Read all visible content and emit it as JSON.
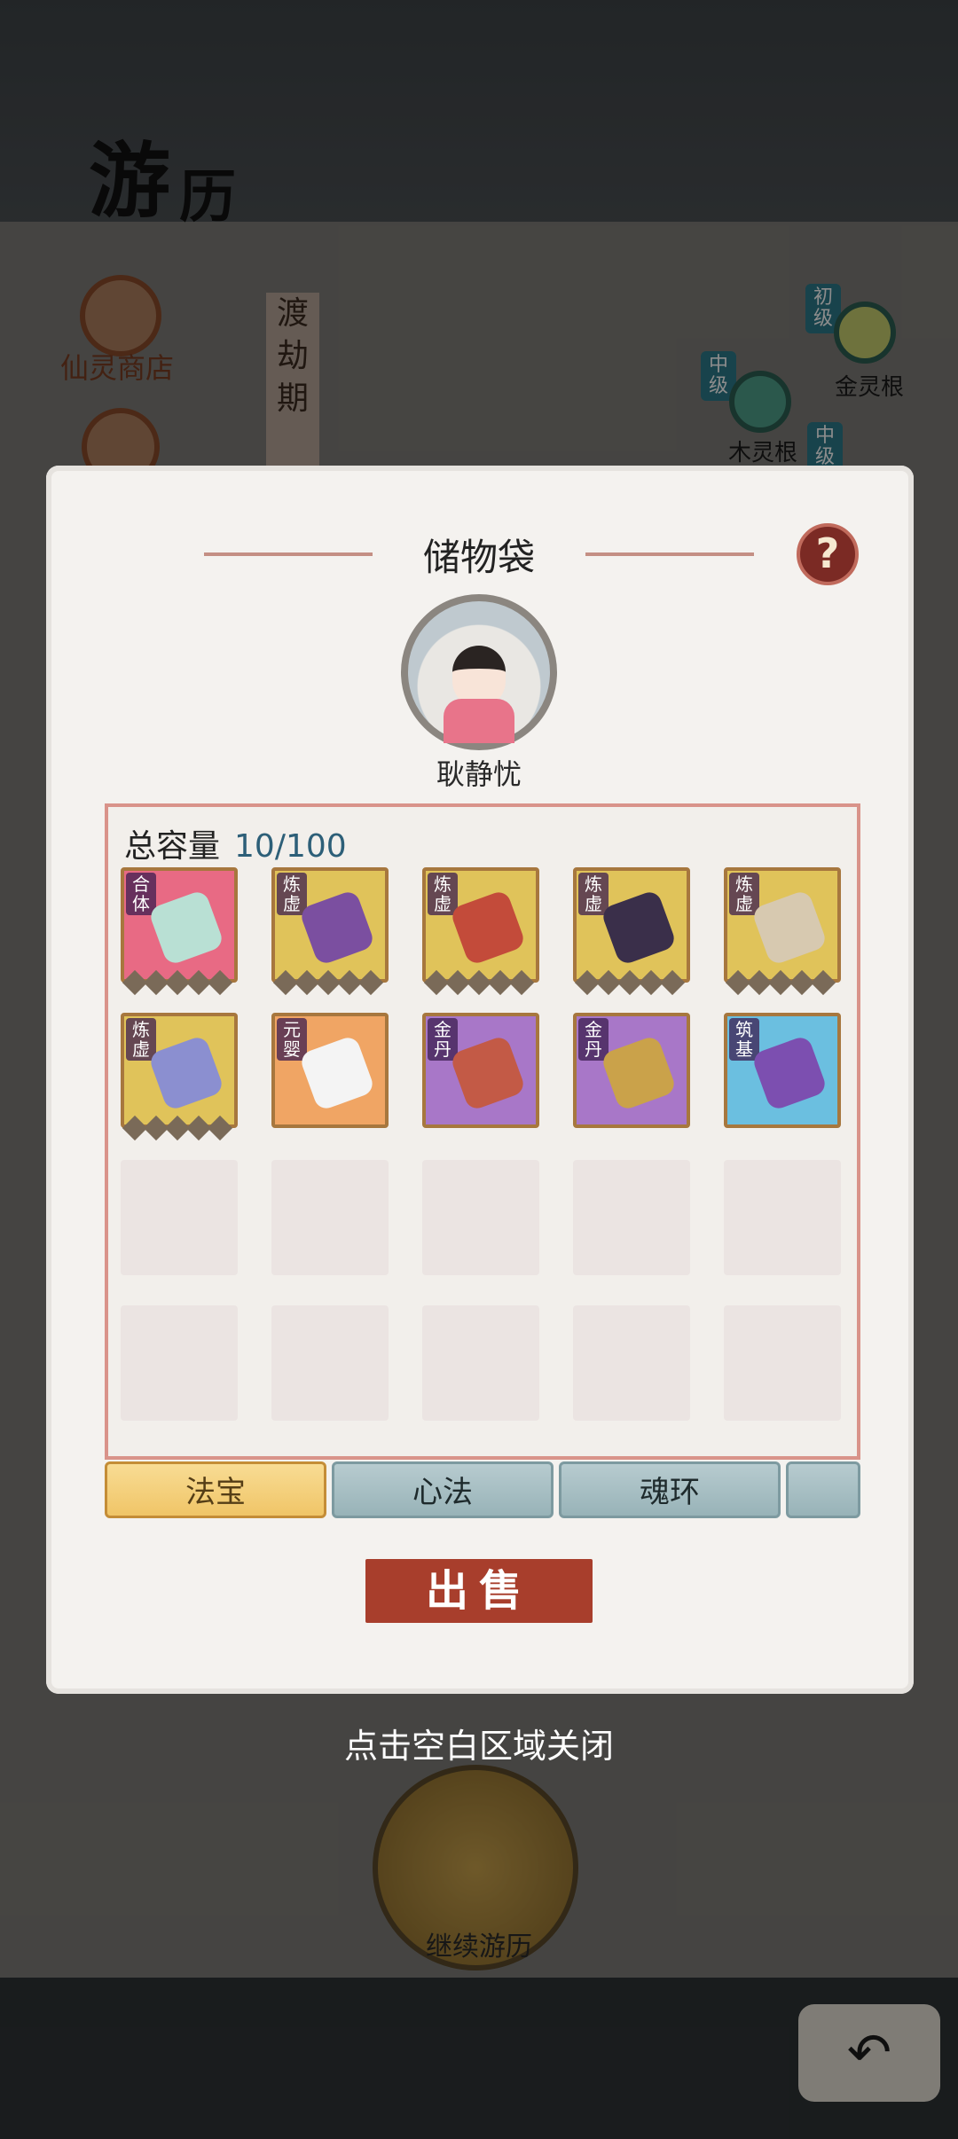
{
  "header": {
    "title_char_1": "游",
    "title_char_2": "历"
  },
  "background": {
    "shop_label": "仙灵商店",
    "tribulation_label": "渡劫期",
    "roots": [
      {
        "badge": "初级",
        "label": "金灵根"
      },
      {
        "badge": "中级",
        "label": "木灵根"
      },
      {
        "badge": "中级",
        "label": ""
      }
    ]
  },
  "modal": {
    "title": "储物袋",
    "help_label": "?",
    "character_name": "耿静忧",
    "capacity_label": "总容量",
    "capacity_value": "10/100",
    "items": [
      {
        "tag": "合体",
        "rarity_color": "#e86a84",
        "icon_color": "#b9e0d4",
        "stars": 5
      },
      {
        "tag": "炼虚",
        "rarity_color": "#e0c35a",
        "icon_color": "#7b4fa0",
        "stars": 5
      },
      {
        "tag": "炼虚",
        "rarity_color": "#e0c35a",
        "icon_color": "#c34b3a",
        "stars": 5
      },
      {
        "tag": "炼虚",
        "rarity_color": "#e0c35a",
        "icon_color": "#3a2f4a",
        "stars": 5
      },
      {
        "tag": "炼虚",
        "rarity_color": "#e0c35a",
        "icon_color": "#d7c9b0",
        "stars": 5
      },
      {
        "tag": "炼虚",
        "rarity_color": "#e0c35a",
        "icon_color": "#8b8fd0",
        "stars": 5
      },
      {
        "tag": "元婴",
        "rarity_color": "#f0a564",
        "icon_color": "#f4f4f4",
        "stars": 0
      },
      {
        "tag": "金丹",
        "rarity_color": "#a877c8",
        "icon_color": "#c35a46",
        "stars": 0
      },
      {
        "tag": "金丹",
        "rarity_color": "#a877c8",
        "icon_color": "#caa24a",
        "stars": 0
      },
      {
        "tag": "筑基",
        "rarity_color": "#6bbfe0",
        "icon_color": "#7c4fb0",
        "stars": 0
      }
    ],
    "tabs": [
      "法宝",
      "心法",
      "魂环",
      ""
    ],
    "active_tab_index": 0,
    "sell_label": "出售"
  },
  "close_hint": "点击空白区域关闭",
  "continue_label": "继续游历",
  "back_icon": "↶"
}
